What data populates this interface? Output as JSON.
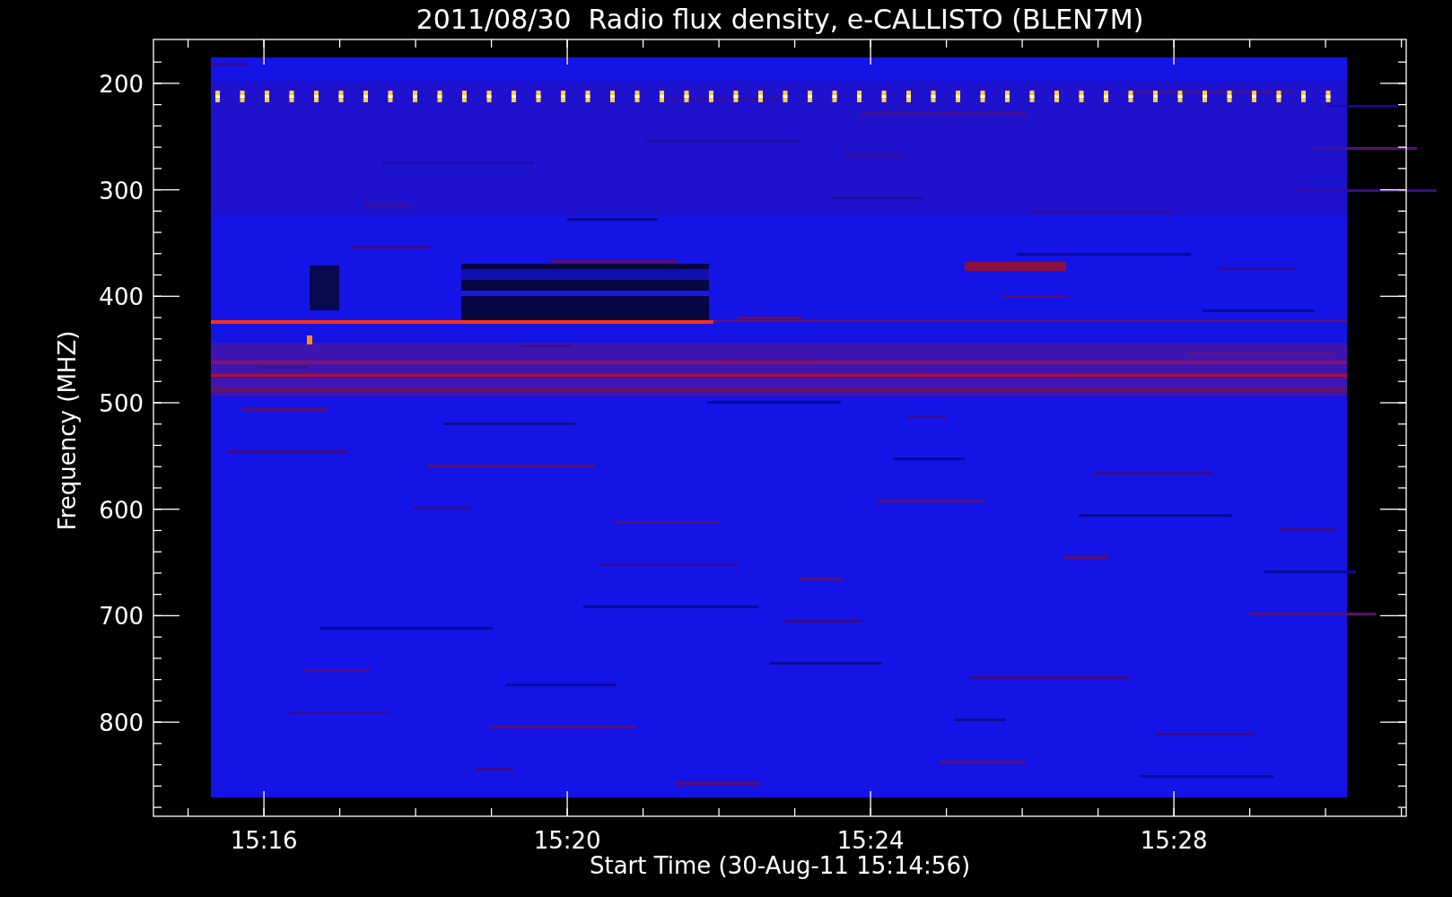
{
  "title": "2011/08/30  Radio flux density, e-CALLISTO (BLEN7M)",
  "y_axis": {
    "label": "Frequency (MHZ)",
    "ticks": [
      "200",
      "300",
      "400",
      "500",
      "600",
      "700",
      "800"
    ]
  },
  "x_axis": {
    "label": "Start Time (30-Aug-11 15:14:56)",
    "ticks": [
      "15:16",
      "15:20",
      "15:24",
      "15:28"
    ]
  }
}
